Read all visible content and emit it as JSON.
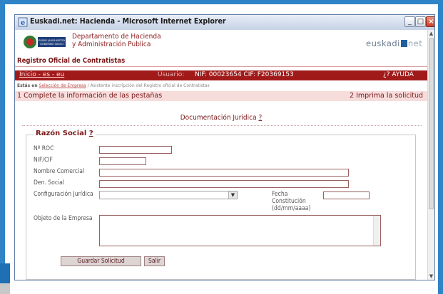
{
  "window": {
    "title": "Euskadi.net: Hacienda - Microsoft Internet Explorer",
    "btn_min": "_",
    "btn_max": "□",
    "btn_close": "×"
  },
  "header": {
    "logo_line1": "EUSKO JAURLARITZA",
    "logo_line2": "GOBIERNO VASCO",
    "dept_line1": "Departamento de Hacienda",
    "dept_line2": "y Administración Publica",
    "brand_a": "euskadi",
    "brand_b": "net"
  },
  "section_title": "Registro Oficial de Contratistas",
  "redbar": {
    "nav": "Inicio - es - eu",
    "user_label": "Usuario:",
    "user_value": "NIF: 00023654 CIF: F20369153",
    "help": "¿? AYUDA"
  },
  "breadcrumb": {
    "prefix": "Estás en",
    "link": "Selección de Empresa",
    "rest": "/ Asistente inscripción del Registro oficial de Contratistas"
  },
  "steps": {
    "step1": "1 Complete la información de las pestañas",
    "step2": "2 Imprima la solicitud"
  },
  "doc_title": "Documentación Jurídica",
  "help_mark": "?",
  "form": {
    "legend": "Razón Social",
    "labels": {
      "roc": "Nº ROC",
      "nif": "NIF/CIF",
      "nombre": "Nombre Comercial",
      "den": "Den. Social",
      "config": "Configuración Jurídica",
      "fecha": "Fecha",
      "fecha2": "Constitución",
      "fecha3": "(dd/mm/aaaa)",
      "objeto": "Objeto de la Empresa"
    },
    "values": {
      "roc": "",
      "nif": "",
      "nombre": "",
      "den": "",
      "config": "",
      "fecha": "",
      "objeto": ""
    }
  },
  "buttons": {
    "guardar": "Guardar Solicitud",
    "salir": "Salir"
  }
}
